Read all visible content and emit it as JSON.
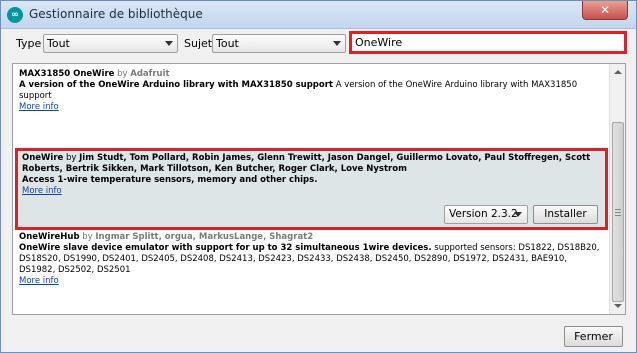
{
  "window": {
    "title": "Gestionnaire de bibliothèque",
    "close_glyph": "✕"
  },
  "filters": {
    "type_label": "Type",
    "type_value": "Tout",
    "subject_label": "Sujet",
    "subject_value": "Tout",
    "search_value": "OneWire"
  },
  "libraries": [
    {
      "name": "MAX31850 OneWire",
      "by": "by",
      "author": "Adafruit",
      "sentence": "A version of the OneWire Arduino library with MAX31850 support",
      "paragraph": "A version of the OneWire Arduino library with MAX31850 support",
      "more_info": "More info"
    },
    {
      "name": "OneWire",
      "by": "by",
      "author": "Jim Studt, Tom Pollard, Robin James, Glenn Trewitt, Jason Dangel, Guillermo Lovato, Paul Stoffregen, Scott Roberts, Bertrik Sikken, Mark Tillotson, Ken Butcher, Roger Clark, Love Nystrom",
      "sentence": "Access 1-wire temperature sensors, memory and other chips.",
      "paragraph": "",
      "more_info": "More info",
      "version": "Version 2.3.2",
      "install_label": "Installer"
    },
    {
      "name": "OneWireHub",
      "by": "by",
      "author": "Ingmar Splitt, orgua, MarkusLange, Shagrat2",
      "sentence": "OneWire slave device emulator with support for up to 32 simultaneous 1wire devices.",
      "paragraph": "supported sensors: DS1822, DS18B20, DS18S20, DS1990, DS2401, DS2405, DS2408, DS2413, DS2423, DS2433, DS2438, DS2450, DS2890, DS1972, DS2431, BAE910, DS1982, DS2502, DS2501",
      "more_info": "More info"
    }
  ],
  "footer": {
    "close_label": "Fermer"
  }
}
